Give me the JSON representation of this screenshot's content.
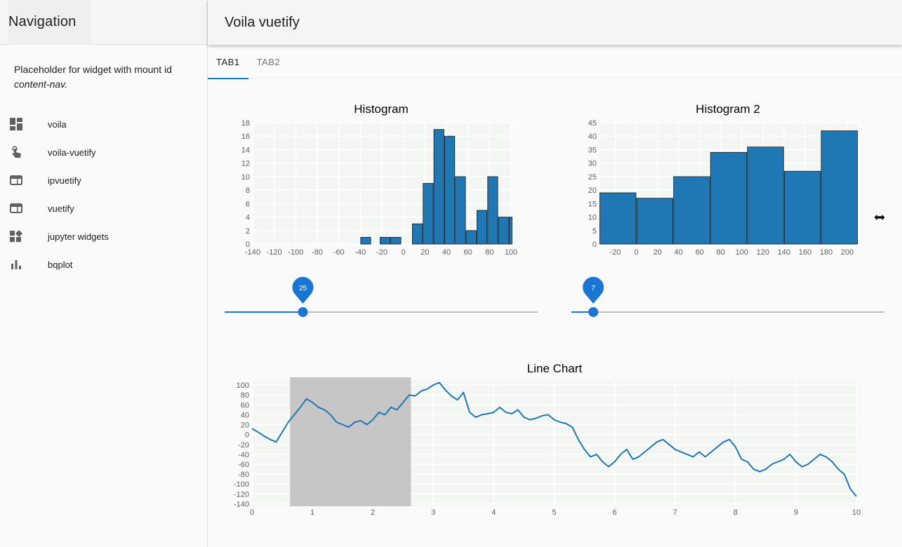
{
  "sidebar": {
    "title": "Navigation",
    "placeholder_text": "Placeholder for widget with mount id",
    "placeholder_id": "content-nav.",
    "items": [
      {
        "label": "voila",
        "icon": "dashboard-icon"
      },
      {
        "label": "voila-vuetify",
        "icon": "touch-app-icon"
      },
      {
        "label": "ipvuetify",
        "icon": "web-icon"
      },
      {
        "label": "vuetify",
        "icon": "web-icon"
      },
      {
        "label": "jupyter widgets",
        "icon": "widgets-icon"
      },
      {
        "label": "bqplot",
        "icon": "bar-chart-icon"
      }
    ]
  },
  "header": {
    "title": "Voila vuetify"
  },
  "tabs": [
    {
      "label": "TAB1",
      "active": true
    },
    {
      "label": "TAB2",
      "active": false
    }
  ],
  "colors": {
    "accent": "#1976d2",
    "bar": "#1f77b4",
    "selection": "#c6c6c6",
    "plot_bg": "#f4f6f4"
  },
  "sliders": [
    {
      "value": 25,
      "fraction": 0.25
    },
    {
      "value": 7,
      "fraction": 0.07
    }
  ],
  "chart_data": [
    {
      "type": "bar",
      "title": "Histogram",
      "xlim": [
        -140,
        100
      ],
      "ylim": [
        0,
        18
      ],
      "xticks": [
        -140,
        -120,
        -100,
        -80,
        -60,
        -40,
        -20,
        0,
        20,
        40,
        60,
        80,
        100
      ],
      "yticks": [
        0,
        2,
        4,
        6,
        8,
        10,
        12,
        14,
        16,
        18
      ],
      "bins": [
        {
          "x0": -40,
          "x1": -30,
          "count": 1
        },
        {
          "x0": -22,
          "x1": -12,
          "count": 1
        },
        {
          "x0": -12,
          "x1": -2,
          "count": 1
        },
        {
          "x0": 8,
          "x1": 18,
          "count": 3
        },
        {
          "x0": 18,
          "x1": 28,
          "count": 9
        },
        {
          "x0": 28,
          "x1": 38,
          "count": 17
        },
        {
          "x0": 38,
          "x1": 48,
          "count": 16
        },
        {
          "x0": 48,
          "x1": 58,
          "count": 10
        },
        {
          "x0": 58,
          "x1": 68,
          "count": 2
        },
        {
          "x0": 68,
          "x1": 78,
          "count": 5
        },
        {
          "x0": 78,
          "x1": 88,
          "count": 10
        },
        {
          "x0": 88,
          "x1": 98,
          "count": 4
        },
        {
          "x0": 98,
          "x1": 108,
          "count": 4
        }
      ]
    },
    {
      "type": "bar",
      "title": "Histogram 2",
      "xlim": [
        -35,
        210
      ],
      "ylim": [
        0,
        45
      ],
      "xticks": [
        -20,
        0,
        20,
        40,
        60,
        80,
        100,
        120,
        140,
        160,
        180,
        200
      ],
      "yticks": [
        0,
        5,
        10,
        15,
        20,
        25,
        30,
        35,
        40,
        45
      ],
      "bins": [
        {
          "x0": -35,
          "x1": 0,
          "count": 19
        },
        {
          "x0": 0,
          "x1": 35,
          "count": 17
        },
        {
          "x0": 35,
          "x1": 70,
          "count": 25
        },
        {
          "x0": 70,
          "x1": 105,
          "count": 34
        },
        {
          "x0": 105,
          "x1": 140,
          "count": 36
        },
        {
          "x0": 140,
          "x1": 175,
          "count": 27
        },
        {
          "x0": 175,
          "x1": 210,
          "count": 42
        }
      ]
    },
    {
      "type": "line",
      "title": "Line Chart",
      "xlim": [
        0,
        10
      ],
      "ylim": [
        -145,
        110
      ],
      "xticks": [
        0,
        1,
        2,
        3,
        4,
        5,
        6,
        7,
        8,
        9,
        10
      ],
      "yticks": [
        100,
        80,
        60,
        40,
        20,
        0,
        -20,
        -40,
        -60,
        -80,
        -100,
        -120,
        -140
      ],
      "selection": [
        0.63,
        2.63
      ],
      "x": [
        0,
        0.1,
        0.2,
        0.3,
        0.4,
        0.5,
        0.6,
        0.7,
        0.8,
        0.9,
        1.0,
        1.1,
        1.2,
        1.3,
        1.4,
        1.5,
        1.6,
        1.7,
        1.8,
        1.9,
        2.0,
        2.1,
        2.2,
        2.3,
        2.4,
        2.5,
        2.6,
        2.7,
        2.8,
        2.9,
        3.0,
        3.1,
        3.2,
        3.3,
        3.4,
        3.5,
        3.6,
        3.7,
        3.8,
        3.9,
        4.0,
        4.1,
        4.2,
        4.3,
        4.4,
        4.5,
        4.6,
        4.7,
        4.8,
        4.9,
        5.0,
        5.1,
        5.2,
        5.3,
        5.4,
        5.5,
        5.6,
        5.7,
        5.8,
        5.9,
        6.0,
        6.1,
        6.2,
        6.3,
        6.4,
        6.5,
        6.6,
        6.7,
        6.8,
        6.9,
        7.0,
        7.1,
        7.2,
        7.3,
        7.4,
        7.5,
        7.6,
        7.7,
        7.8,
        7.9,
        8.0,
        8.1,
        8.2,
        8.3,
        8.4,
        8.5,
        8.6,
        8.7,
        8.8,
        8.9,
        9.0,
        9.1,
        9.2,
        9.3,
        9.4,
        9.5,
        9.6,
        9.7,
        9.8,
        9.9,
        10.0
      ],
      "y": [
        12,
        5,
        -3,
        -10,
        -15,
        5,
        25,
        40,
        55,
        72,
        65,
        55,
        50,
        40,
        25,
        20,
        15,
        25,
        28,
        20,
        30,
        45,
        40,
        55,
        50,
        65,
        80,
        78,
        88,
        92,
        100,
        105,
        90,
        78,
        70,
        85,
        45,
        35,
        40,
        42,
        45,
        55,
        45,
        42,
        50,
        35,
        30,
        33,
        38,
        40,
        30,
        25,
        22,
        15,
        -10,
        -30,
        -45,
        -40,
        -55,
        -65,
        -55,
        -40,
        -30,
        -50,
        -45,
        -35,
        -25,
        -15,
        -10,
        -20,
        -30,
        -35,
        -40,
        -45,
        -35,
        -45,
        -35,
        -25,
        -15,
        -10,
        -25,
        -50,
        -55,
        -70,
        -75,
        -70,
        -60,
        -55,
        -50,
        -40,
        -55,
        -65,
        -60,
        -50,
        -40,
        -45,
        -55,
        -70,
        -80,
        -110,
        -125
      ]
    }
  ]
}
